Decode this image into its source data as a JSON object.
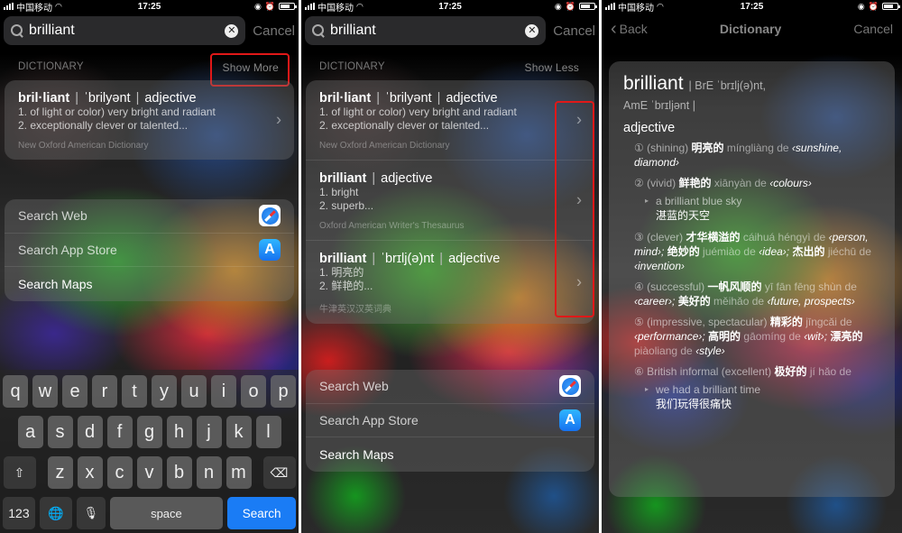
{
  "status_bar": {
    "carrier": "中国移动",
    "time": "17:25"
  },
  "search": {
    "query": "brilliant",
    "cancel_label": "Cancel"
  },
  "panel1": {
    "section_title": "DICTIONARY",
    "toggle_label": "Show More",
    "dictionary_results": [
      {
        "headword": "bril·liant",
        "pronunciation": "ˈbrilyənt",
        "pos": "adjective",
        "lines": [
          "1. of light or color) very bright and radiant",
          "2. exceptionally clever or talented..."
        ],
        "source": "New Oxford American Dictionary"
      }
    ],
    "actions": [
      {
        "label": "Search Web",
        "icon": "safari-icon"
      },
      {
        "label": "Search App Store",
        "icon": "app-store-icon"
      },
      {
        "label": "Search Maps",
        "icon": ""
      }
    ],
    "keyboard": {
      "row1": [
        "q",
        "w",
        "e",
        "r",
        "t",
        "y",
        "u",
        "i",
        "o",
        "p"
      ],
      "row2": [
        "a",
        "s",
        "d",
        "f",
        "g",
        "h",
        "j",
        "k",
        "l"
      ],
      "row3": [
        "z",
        "x",
        "c",
        "v",
        "b",
        "n",
        "m"
      ],
      "numbers_label": "123",
      "space_label": "space",
      "search_label": "Search"
    }
  },
  "panel2": {
    "section_title": "DICTIONARY",
    "toggle_label": "Show Less",
    "dictionary_results": [
      {
        "headword": "bril·liant",
        "pronunciation": "ˈbrilyənt",
        "pos": "adjective",
        "lines": [
          "1. of light or color) very bright and radiant",
          "2. exceptionally clever or talented..."
        ],
        "source": "New Oxford American Dictionary"
      },
      {
        "headword": "brilliant",
        "pronunciation": "",
        "pos": "adjective",
        "lines": [
          "1. bright",
          "2. superb..."
        ],
        "source": "Oxford American Writer's Thesaurus"
      },
      {
        "headword": "brilliant",
        "pronunciation": "ˈbrɪlj(ə)nt",
        "pos": "adjective",
        "lines": [
          "1. 明亮的",
          "2. 鲜艳的..."
        ],
        "source": "牛津英汉汉英词典"
      }
    ],
    "actions": [
      {
        "label": "Search Web",
        "icon": "safari-icon"
      },
      {
        "label": "Search App Store",
        "icon": "app-store-icon"
      },
      {
        "label": "Search Maps",
        "icon": ""
      }
    ]
  },
  "panel3": {
    "back_label": "Back",
    "title": "Dictionary",
    "cancel_label": "Cancel",
    "entry": {
      "word": "brilliant",
      "pron_line1": "| BrE ˈbrɪlj(ə)nt,",
      "pron_line2": "AmE ˈbrɪljənt |",
      "pos": "adjective",
      "senses": [
        {
          "num": "①",
          "gloss": "(shining)",
          "parts": [
            {
              "zh": "明亮的",
              "py": "míngliàng de",
              "col": "‹sunshine, diamond›"
            }
          ]
        },
        {
          "num": "②",
          "gloss": "(vivid)",
          "parts": [
            {
              "zh": "鲜艳的",
              "py": "xiānyàn de",
              "col": "‹colours›"
            }
          ],
          "example": {
            "en": "a brilliant blue sky",
            "zh": "湛蓝的天空"
          }
        },
        {
          "num": "③",
          "gloss": "(clever)",
          "parts": [
            {
              "zh": "才华横溢的",
              "py": "cáihuá héngyì de",
              "col": "‹person, mind›;"
            },
            {
              "zh": "绝妙的",
              "py": "juémiào de",
              "col": "‹idea›;"
            },
            {
              "zh": "杰出的",
              "py": "jiéchū de",
              "col": "‹invention›"
            }
          ]
        },
        {
          "num": "④",
          "gloss": "(successful)",
          "parts": [
            {
              "zh": "一帆风顺的",
              "py": "yī fān fēng shùn de",
              "col": "‹career›;"
            },
            {
              "zh": "美好的",
              "py": "měihǎo de",
              "col": "‹future, prospects›"
            }
          ]
        },
        {
          "num": "⑤",
          "gloss": "(impressive, spectacular)",
          "parts": [
            {
              "zh": "精彩的",
              "py": "jīngcǎi de",
              "col": "‹performance›;"
            },
            {
              "zh": "高明的",
              "py": "gāomíng de",
              "col": "‹wit›;"
            },
            {
              "zh": "漂亮的",
              "py": "piàoliang de",
              "col": "‹style›"
            }
          ]
        },
        {
          "num": "⑥",
          "gloss": "British informal (excellent)",
          "parts": [
            {
              "zh": "极好的",
              "py": "jí hǎo de",
              "col": ""
            }
          ],
          "example": {
            "en": "we had a brilliant time",
            "zh": "我们玩得很痛快"
          }
        }
      ]
    }
  }
}
